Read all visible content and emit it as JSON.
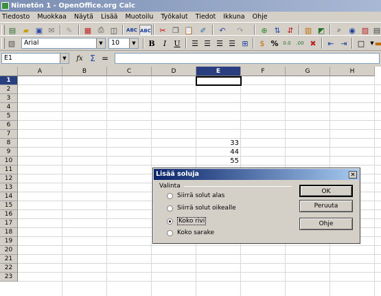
{
  "window": {
    "title": "Nimetön 1 - OpenOffice.org Calc"
  },
  "menu": [
    "Tiedosto",
    "Muokkaa",
    "Näytä",
    "Lisää",
    "Muotoilu",
    "Työkalut",
    "Tiedot",
    "Ikkuna",
    "Ohje"
  ],
  "format_toolbar": {
    "font_name": "Arial",
    "font_size": "10"
  },
  "formula_bar": {
    "name_box": "E1",
    "function_wizard": "fx",
    "sum": "Σ",
    "equals": "="
  },
  "sheet": {
    "columns": [
      "A",
      "B",
      "C",
      "D",
      "E",
      "F",
      "G",
      "H"
    ],
    "rows": [
      "1",
      "2",
      "3",
      "4",
      "5",
      "6",
      "7",
      "8",
      "9",
      "10",
      "11",
      "12",
      "13",
      "14",
      "15",
      "16",
      "17",
      "18",
      "19",
      "20",
      "21",
      "22",
      "23"
    ],
    "selected_cell": "E1",
    "cells": [
      {
        "ref": "E8",
        "value": "33"
      },
      {
        "ref": "E9",
        "value": "44"
      },
      {
        "ref": "E10",
        "value": "55"
      }
    ]
  },
  "dialog": {
    "title": "Lisää soluja",
    "group_label": "Valinta",
    "options": [
      {
        "label": "Siirrä solut alas",
        "selected": false
      },
      {
        "label": "Siirrä solut oikealle",
        "selected": false
      },
      {
        "label": "Koko rivi",
        "selected": true
      },
      {
        "label": "Koko sarake",
        "selected": false
      }
    ],
    "buttons": {
      "ok": "OK",
      "cancel": "Peruuta",
      "help": "Ohje"
    }
  },
  "colors": {
    "title_bar": "#7b8fb4",
    "dialog_title": "#0a246a",
    "selected_header": "#2a3f7f"
  }
}
